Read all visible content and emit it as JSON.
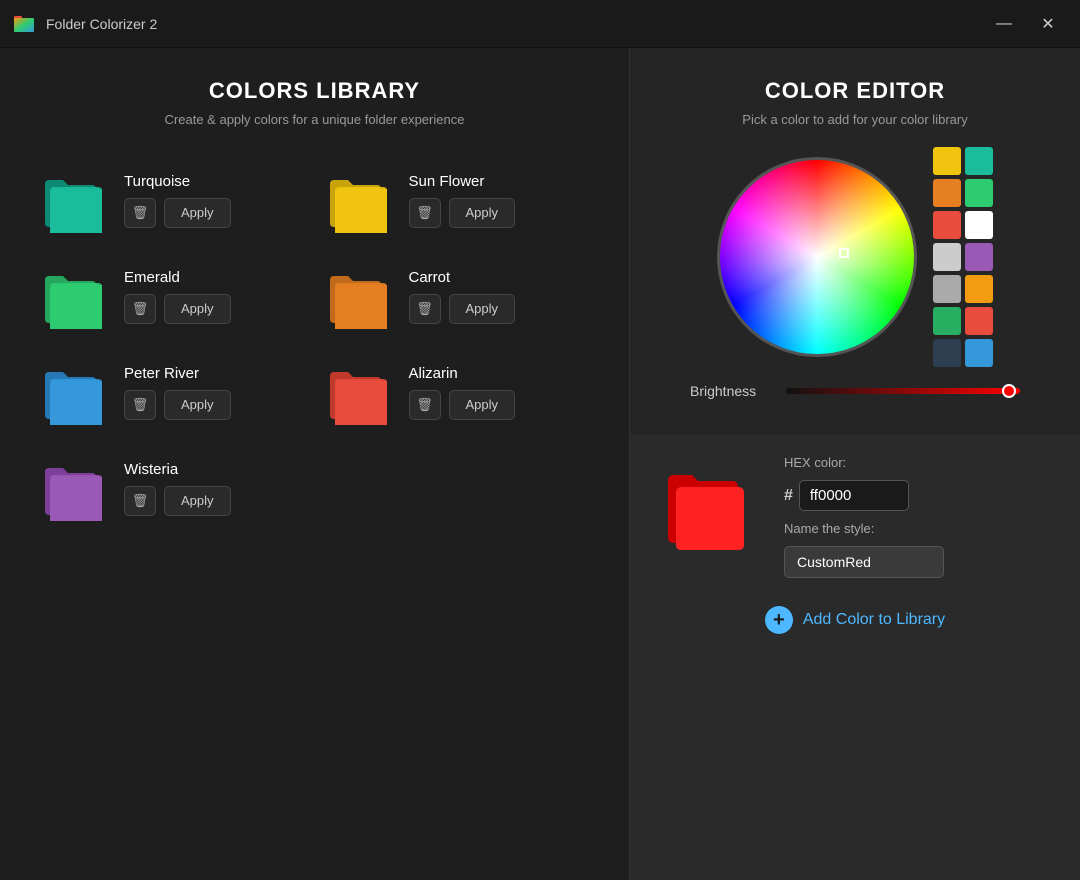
{
  "app": {
    "title": "Folder Colorizer 2",
    "minimize_label": "—",
    "close_label": "✕"
  },
  "left_panel": {
    "title": "COLORS LIBRARY",
    "subtitle": "Create & apply colors for a unique folder experience",
    "colors": [
      {
        "id": "turquoise",
        "name": "Turquoise",
        "color": "#1abc9c",
        "shadow": "#0d8a73"
      },
      {
        "id": "sun-flower",
        "name": "Sun Flower",
        "color": "#f1c40f",
        "shadow": "#c9a30b"
      },
      {
        "id": "emerald",
        "name": "Emerald",
        "color": "#2ecc71",
        "shadow": "#25a85d"
      },
      {
        "id": "carrot",
        "name": "Carrot",
        "color": "#e67e22",
        "shadow": "#c26a1b"
      },
      {
        "id": "peter-river",
        "name": "Peter River",
        "color": "#3498db",
        "shadow": "#2779b5"
      },
      {
        "id": "alizarin",
        "name": "Alizarin",
        "color": "#e74c3c",
        "shadow": "#c0392b"
      },
      {
        "id": "wisteria",
        "name": "Wisteria",
        "color": "#9b59b6",
        "shadow": "#7d3f99"
      }
    ],
    "apply_label": "Apply",
    "delete_icon": "🗑"
  },
  "right_panel": {
    "title": "COLOR EDITOR",
    "subtitle": "Pick a color to add for your color library",
    "brightness_label": "Brightness",
    "hex_label": "HEX color:",
    "hex_hash": "#",
    "hex_value": "ff0000",
    "name_label": "Name the style:",
    "name_value": "CustomRed",
    "add_label": "Add Color to Library",
    "swatches": [
      "#f1c40f",
      "#1abc9c",
      "#e67e22",
      "#2ecc71",
      "#e74c3c",
      "#ffffff",
      "#cccccc",
      "#9b59b6",
      "#aaaaaa",
      "#f39c12",
      "#27ae60",
      "#e74c3c",
      "#2c3e50",
      "#3498db"
    ]
  }
}
